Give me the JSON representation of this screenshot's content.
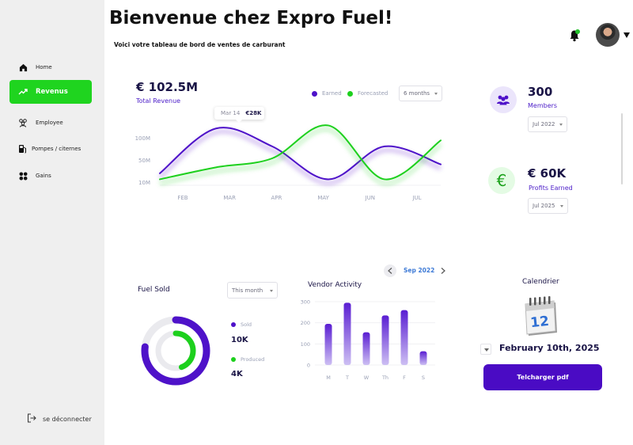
{
  "sidebar": {
    "items": [
      {
        "label": "Home",
        "icon": "home-icon"
      },
      {
        "label": "Revenus",
        "icon": "trend-up-icon",
        "active": true
      },
      {
        "label": "Employee",
        "icon": "people-icon"
      },
      {
        "label": "Pompes / citernes",
        "icon": "fuel-pump-icon"
      },
      {
        "label": "Gains",
        "icon": "grid-icon"
      }
    ],
    "logout_label": "se déconnecter"
  },
  "header": {
    "title": "Bienvenue chez Expro Fuel!",
    "subtitle": "Voici votre tableau de bord de ventes de carburant"
  },
  "colors": {
    "accent": "#4a0bc4",
    "active_nav": "#1fd41f",
    "earned": "#4e12c9",
    "forecasted": "#1dd01d"
  },
  "revenue": {
    "total_value": "€ 102.5M",
    "total_label": "Total Revenue",
    "legend_earned": "Earned",
    "legend_forecasted": "Forecasted",
    "period_select": "6 months",
    "tooltip_date": "Mar 14",
    "tooltip_value": "€28K",
    "y_ticks": [
      "100M",
      "50M",
      "10M"
    ],
    "x_ticks": [
      "FEB",
      "MAR",
      "APR",
      "MAY",
      "JUN",
      "JUL"
    ]
  },
  "stats": {
    "members_value": "300",
    "members_label": "Members",
    "members_select": "Jul 2022",
    "profits_value": "€ 60K",
    "profits_label": "Profits Earned",
    "profits_select": "Jul 2025"
  },
  "fuel_sold": {
    "title": "Fuel Sold",
    "period_select": "This month",
    "sold_label": "Sold",
    "sold_value": "10K",
    "produced_label": "Produced",
    "produced_value": "4K"
  },
  "vendor_activity": {
    "title": "Vendor Activity",
    "month_label": "Sep 2022",
    "y_ticks": [
      "300",
      "200",
      "100",
      "0"
    ]
  },
  "calendar": {
    "title": "Calendrier",
    "icon_day": "12",
    "selected_date": "February 10th, 2025",
    "download_label": "Telcharger pdf"
  },
  "chart_data": [
    {
      "type": "line",
      "x": [
        "FEB",
        "MAR",
        "APR",
        "MAY",
        "JUN",
        "JUL"
      ],
      "ylim": [
        10,
        100
      ],
      "series": [
        {
          "name": "Earned",
          "values": [
            30,
            105,
            75,
            20,
            75,
            45
          ]
        },
        {
          "name": "Forecasted",
          "values": [
            20,
            40,
            55,
            110,
            20,
            85
          ]
        }
      ],
      "grid": false
    },
    {
      "type": "bar",
      "categories": [
        "M",
        "T",
        "W",
        "Th",
        "F",
        "S"
      ],
      "values": [
        195,
        295,
        155,
        235,
        260,
        65
      ],
      "ylim": [
        0,
        300
      ]
    },
    {
      "type": "pie",
      "labels": [
        "Sold",
        "Produced"
      ],
      "values": [
        10,
        4
      ]
    }
  ]
}
